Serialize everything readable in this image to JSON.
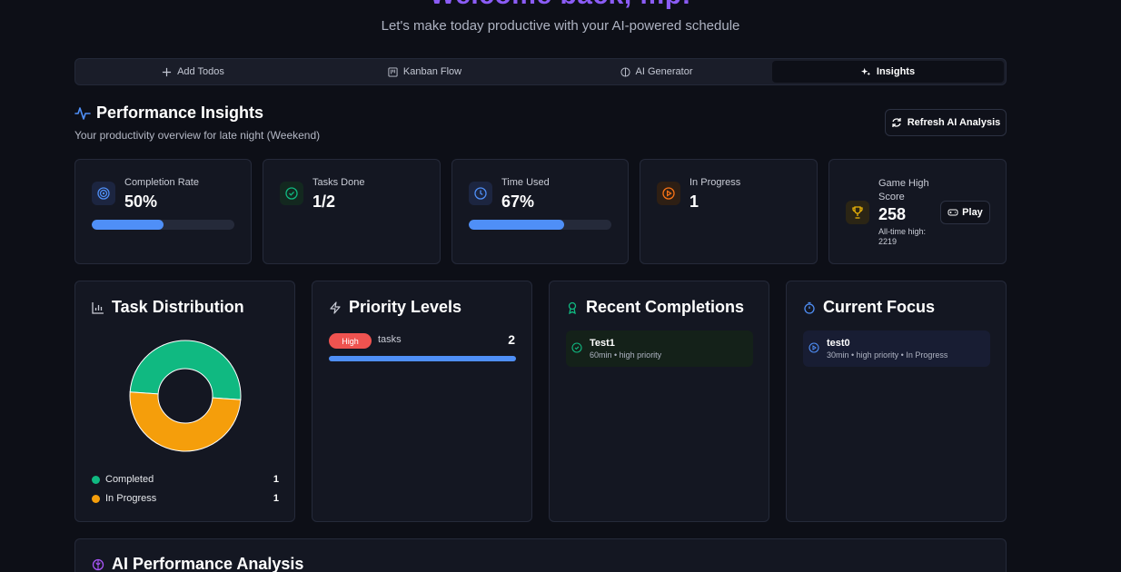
{
  "header": {
    "welcome": "Welcome back, mp!",
    "subtitle": "Let's make today productive with your AI-powered schedule"
  },
  "tabs": [
    {
      "label": "Add Todos",
      "icon": "plus-icon"
    },
    {
      "label": "Kanban Flow",
      "icon": "kanban-icon"
    },
    {
      "label": "AI Generator",
      "icon": "brain-icon"
    },
    {
      "label": "Insights",
      "icon": "sparkles-icon",
      "active": true
    }
  ],
  "insights": {
    "title": "Performance Insights",
    "subtitle": "Your productivity overview for late night (Weekend)",
    "refresh_label": "Refresh AI Analysis"
  },
  "stats": {
    "completion": {
      "label": "Completion Rate",
      "value": "50%",
      "progress": 0.5
    },
    "tasks_done": {
      "label": "Tasks Done",
      "value": "1/2"
    },
    "time_used": {
      "label": "Time Used",
      "value": "67%",
      "progress": 0.67
    },
    "in_progress": {
      "label": "In Progress",
      "value": "1"
    },
    "game": {
      "label": "Game High Score",
      "value": "258",
      "alltime": "All-time high: 2219",
      "play_label": "Play"
    }
  },
  "distribution": {
    "title": "Task Distribution",
    "legend": [
      {
        "label": "Completed",
        "count": "1",
        "color": "#10b981"
      },
      {
        "label": "In Progress",
        "count": "1",
        "color": "#f59e0b"
      }
    ]
  },
  "chart_data": {
    "type": "pie",
    "categories": [
      "Completed",
      "In Progress"
    ],
    "values": [
      1,
      1
    ],
    "colors": [
      "#10b981",
      "#f59e0b"
    ]
  },
  "priority": {
    "title": "Priority Levels",
    "badge": "High",
    "label": "tasks",
    "count": "2"
  },
  "recent": {
    "title": "Recent Completions",
    "items": [
      {
        "title": "Test1",
        "meta": "60min • high priority"
      }
    ]
  },
  "focus": {
    "title": "Current Focus",
    "items": [
      {
        "title": "test0",
        "meta": "30min • high priority • In Progress"
      }
    ]
  },
  "analysis": {
    "title": "AI Performance Analysis"
  },
  "colors": {
    "accent": "#4f8ff7",
    "purple": "#8b5cf6",
    "green": "#10b981",
    "orange": "#f59e0b",
    "red": "#ef5350"
  }
}
